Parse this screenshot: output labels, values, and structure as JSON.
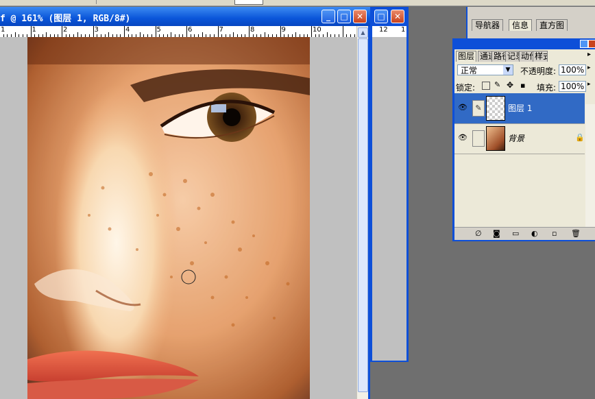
{
  "document": {
    "title": "f @ 161% (图层 1, RGB/8#)",
    "ruler_labels": [
      "1",
      "1",
      "2",
      "3",
      "4",
      "5",
      "6",
      "7",
      "8",
      "9",
      "10"
    ]
  },
  "second_window": {
    "ruler_labels": [
      "12",
      "1"
    ]
  },
  "info_panel": {
    "tabs": [
      "导航器",
      "信息",
      "直方图"
    ]
  },
  "layers_panel": {
    "tabs": [
      "图层",
      "通道",
      "路径",
      "记录",
      "动作",
      "样式"
    ],
    "blend_mode": "正常",
    "opacity_label": "不透明度:",
    "opacity_value": "100%",
    "lock_label": "锁定:",
    "fill_label": "填充:",
    "fill_value": "100%",
    "layers": [
      {
        "name": "图层 1",
        "selected": true,
        "locked": false
      },
      {
        "name": "背景",
        "selected": false,
        "locked": true
      }
    ]
  },
  "colors": {
    "title_blue": "#0a55d9",
    "selected_row": "#316ac5",
    "panel_bg": "#ece9d8"
  }
}
